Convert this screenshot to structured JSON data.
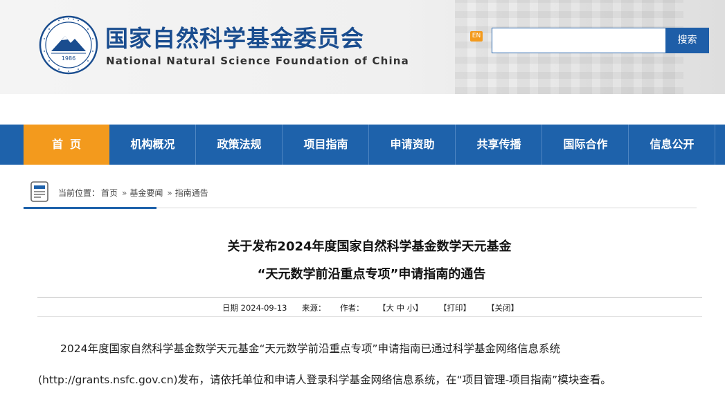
{
  "header": {
    "org_name_cn": "国家自然科学基金委员会",
    "org_name_en": "National Natural Science Foundation of China",
    "emblem_year": "1986",
    "en_badge": "EN",
    "search_placeholder": "",
    "search_button": "搜索"
  },
  "nav": {
    "items": [
      {
        "label": "首页"
      },
      {
        "label": "机构概况"
      },
      {
        "label": "政策法规"
      },
      {
        "label": "项目指南"
      },
      {
        "label": "申请资助"
      },
      {
        "label": "共享传播"
      },
      {
        "label": "国际合作"
      },
      {
        "label": "信息公开"
      }
    ],
    "active_index": 0
  },
  "breadcrumb": {
    "prefix": "当前位置：",
    "items": [
      "首页",
      "基金要闻",
      "指南通告"
    ],
    "separator": "»"
  },
  "article": {
    "title_line1": "关于发布2024年度国家自然科学基金数学天元基金",
    "title_line2": "“天元数学前沿重点专项”申请指南的通告",
    "meta": {
      "date_label": "日期",
      "date": "2024-09-13",
      "source_label": "来源：",
      "author_label": "作者：",
      "font_size_ctrl": "【大 中 小】",
      "print": "【打印】",
      "close": "【关闭】"
    },
    "paragraph_line1": "2024年度国家自然科学基金数学天元基金“天元数学前沿重点专项”申请指南已通过科学基金网络信息系统",
    "paragraph_line2": "(http://grants.nsfc.gov.cn)发布，请依托单位和申请人登录科学基金网络信息系统，在“项目管理-项目指南”模块查看。"
  },
  "colors": {
    "nav_bg": "#1e62ab",
    "nav_active": "#f39a1d",
    "brand_blue": "#1a4d8f"
  }
}
